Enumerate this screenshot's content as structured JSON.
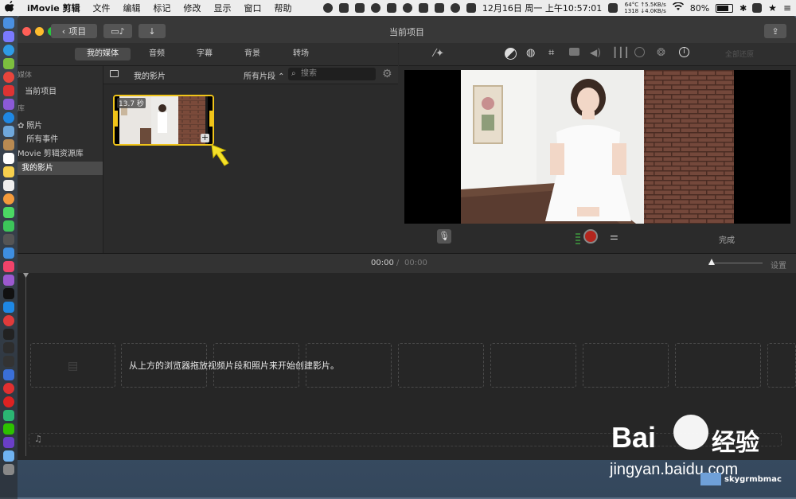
{
  "menubar": {
    "app_name": "iMovie 剪辑",
    "items": [
      "文件",
      "编辑",
      "标记",
      "修改",
      "显示",
      "窗口",
      "帮助"
    ],
    "net_top": "64°C ↑5.5KB/s",
    "net_bottom": "1318 ↓4.0KB/s",
    "clock": "12月16日 周一 上午10:57:01",
    "battery": "80%"
  },
  "window": {
    "back_button": "项目",
    "title": "当前项目"
  },
  "browser": {
    "tabs": [
      "我的媒体",
      "音频",
      "字幕",
      "背景",
      "转场"
    ],
    "active_tab": "我的媒体",
    "header_title": "我的影片",
    "filter": "所有片段 ⌃",
    "search_placeholder": "搜索",
    "clip_duration": "13.7 秒"
  },
  "sidebar": {
    "media_header": "媒体",
    "current_project": "当前项目",
    "library_header": "库",
    "photos": "照片",
    "all_events": "所有事件",
    "library_name": "Movie 剪辑资源库",
    "my_movies": "我的影片"
  },
  "viewer": {
    "reset_all": "全部还原",
    "done": "完成"
  },
  "timeline": {
    "current_time": "00:00",
    "separator": "/",
    "total_time": "00:00",
    "settings": "设置",
    "drop_hint": "从上方的浏览器拖放视频片段和照片来开始创建影片。"
  },
  "watermark": {
    "brand": "Bai",
    "brand_cn": "经验",
    "url": "jingyan.baidu.com",
    "user": "skygrmbmac"
  },
  "colors": {
    "accent_yellow": "#f0c419",
    "record_red": "#b3261e"
  }
}
